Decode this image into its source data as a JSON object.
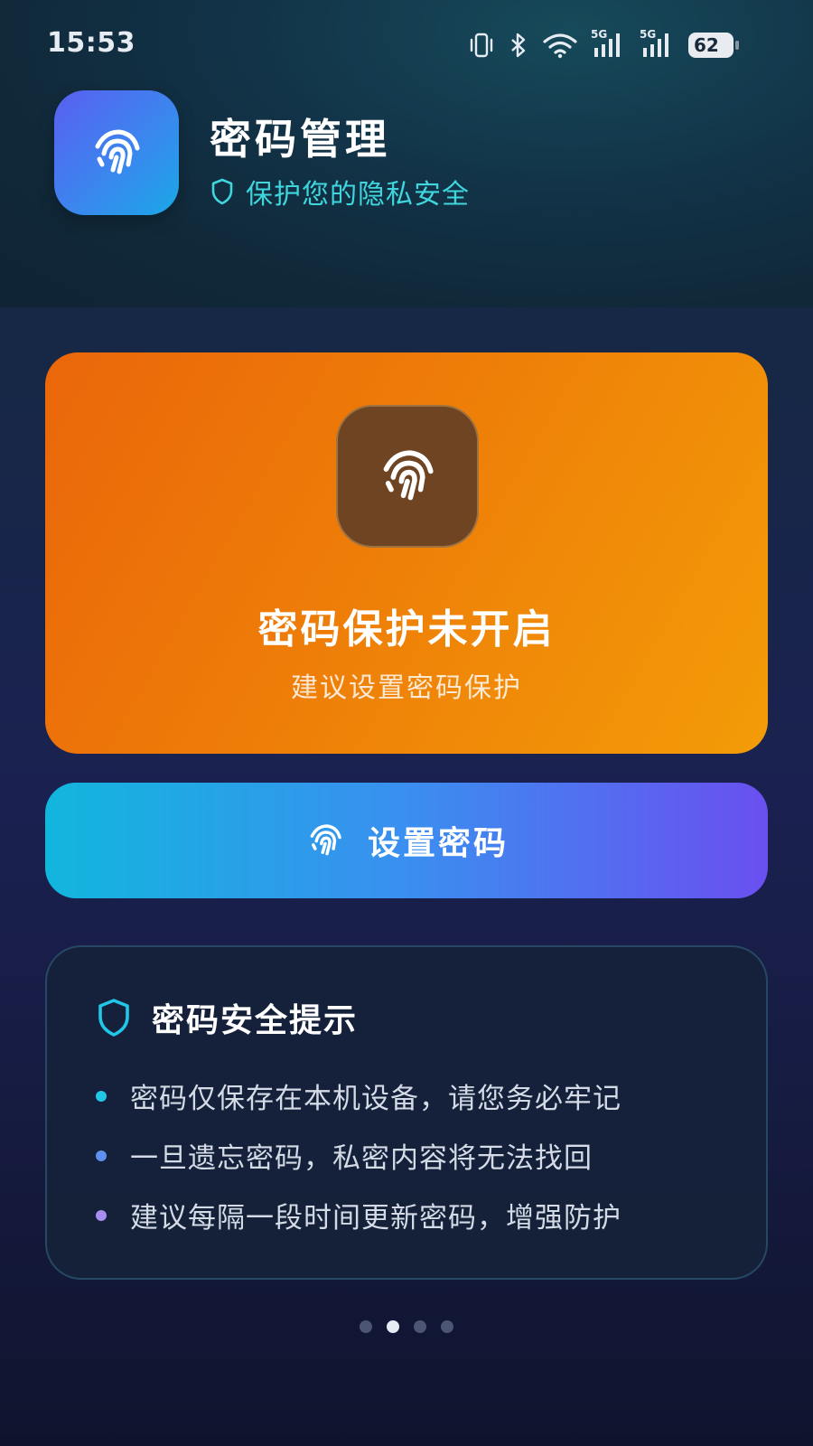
{
  "status_bar": {
    "time": "15:53",
    "network_1": "5G",
    "network_2": "5G",
    "battery": "62"
  },
  "header": {
    "title": "密码管理",
    "subtitle": "保护您的隐私安全",
    "icon": "fingerprint-icon",
    "subtitle_icon": "shield-icon"
  },
  "status_card": {
    "title": "密码保护未开启",
    "subtitle": "建议设置密码保护",
    "icon": "fingerprint-icon"
  },
  "set_password_button": {
    "label": "设置密码",
    "icon": "fingerprint-icon"
  },
  "tips": {
    "title": "密码安全提示",
    "icon": "shield-icon",
    "items": [
      {
        "text": "密码仅保存在本机设备，请您务必牢记",
        "dot_color": "#22c6e6"
      },
      {
        "text": "一旦遗忘密码，私密内容将无法找回",
        "dot_color": "#5f8ff0"
      },
      {
        "text": "建议每隔一段时间更新密码，增强防护",
        "dot_color": "#a88ef0"
      }
    ]
  },
  "pagination": {
    "count": 4,
    "active_index": 1
  },
  "colors": {
    "accent_cyan": "#3fd6dd",
    "warning_orange": "#ee7d08",
    "button_gradient_start": "#12b6dd",
    "button_gradient_end": "#6a4ff0"
  }
}
